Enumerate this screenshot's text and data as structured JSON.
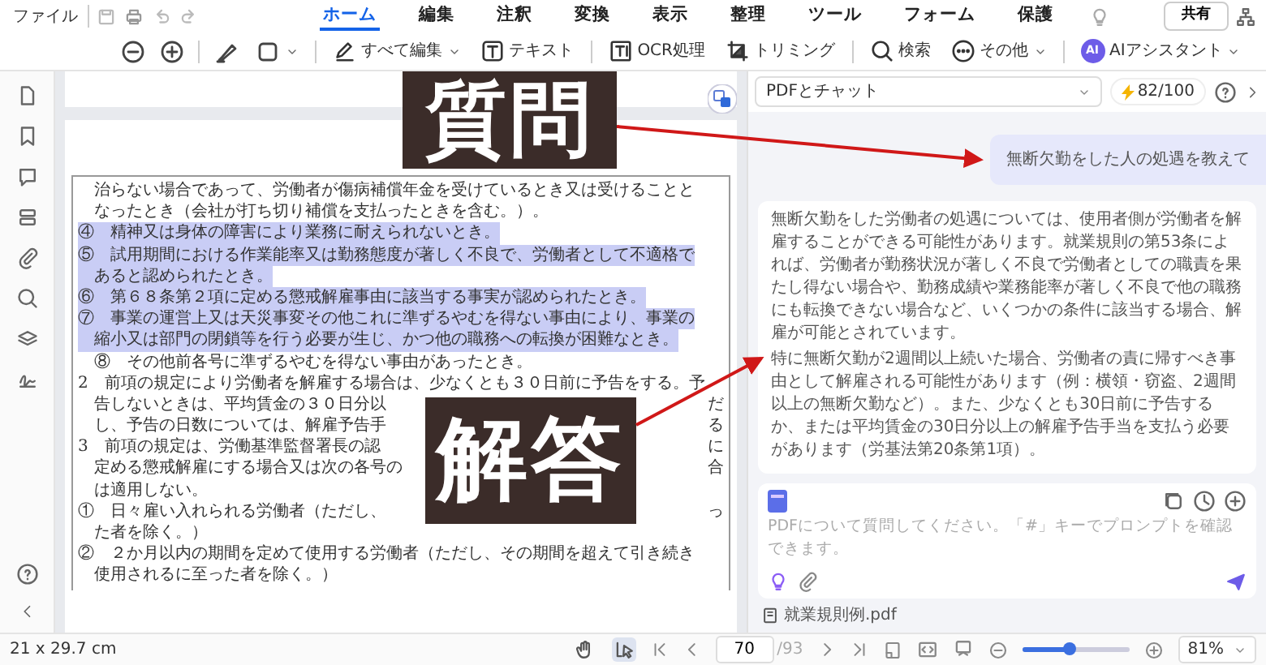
{
  "menu": {
    "file": "ファイル",
    "tabs": [
      {
        "label": "ホーム",
        "selected": true
      },
      {
        "label": "編集",
        "selected": false
      },
      {
        "label": "注釈",
        "selected": false
      },
      {
        "label": "変換",
        "selected": false
      },
      {
        "label": "表示",
        "selected": false
      },
      {
        "label": "整理",
        "selected": false
      },
      {
        "label": "ツール",
        "selected": false
      },
      {
        "label": "フォーム",
        "selected": false
      },
      {
        "label": "保護",
        "selected": false
      }
    ],
    "share": "共有"
  },
  "toolbar": {
    "tools": [
      {
        "label": "すべて編集",
        "dropdown": true
      },
      {
        "label": "テキスト",
        "dropdown": false
      },
      {
        "label": "OCR処理",
        "dropdown": false
      },
      {
        "label": "トリミング",
        "dropdown": false
      },
      {
        "label": "検索",
        "dropdown": false
      },
      {
        "label": "その他",
        "dropdown": true
      },
      {
        "label": "AIアシスタント",
        "dropdown": true
      }
    ],
    "ai_badge": "AI"
  },
  "document": {
    "lines": [
      {
        "text": "治らない場合であって、労働者が傷病補償年金を受けているとき又は受けることと",
        "hanging": true,
        "highlighted": false
      },
      {
        "text": "なったとき（会社が打ち切り補償を支払ったときを含む。）。",
        "hanging": true,
        "highlighted": false
      },
      {
        "text": "④　精神又は身体の障害により業務に耐えられないとき。",
        "hanging": false,
        "highlighted": true
      },
      {
        "text": "⑤　試用期間における作業能率又は勤務態度が著しく不良で、労働者として不適格で",
        "hanging": false,
        "highlighted": true
      },
      {
        "text": "あると認められたとき。",
        "hanging": true,
        "highlighted": true
      },
      {
        "text": "⑥　第６８条第２項に定める懲戒解雇事由に該当する事実が認められたとき。",
        "hanging": false,
        "highlighted": true
      },
      {
        "text": "⑦　事業の運営上又は天災事変その他これに準ずるやむを得ない事由により、事業の",
        "hanging": false,
        "highlighted": true
      },
      {
        "text": "縮小又は部門の閉鎖等を行う必要が生じ、かつ他の職務への転換が困難なとき。",
        "hanging": true,
        "highlighted": true
      },
      {
        "text": "⑧　その他前各号に準ずるやむを得ない事由があったとき。",
        "hanging": true,
        "highlighted": false
      },
      {
        "text": "2　前項の規定により労働者を解雇する場合は、少なくとも３０日前に予告をする。予",
        "hanging": false,
        "highlighted": false
      },
      {
        "text": "告しないときは、平均賃金の３０日分以",
        "right": "だ",
        "hanging": true,
        "highlighted": false
      },
      {
        "text": "し、予告の日数については、解雇予告手",
        "right": "る",
        "hanging": true,
        "highlighted": false
      },
      {
        "text": "3　前項の規定は、労働基準監督署長の認",
        "right": "に",
        "hanging": false,
        "highlighted": false
      },
      {
        "text": "定める懲戒解雇にする場合又は次の各号の",
        "right": "合",
        "hanging": true,
        "highlighted": false
      },
      {
        "text": "は適用しない。",
        "hanging": true,
        "highlighted": false
      },
      {
        "text": "①　日々雇い入れられる労働者（ただし、",
        "right": "っ",
        "hanging": false,
        "highlighted": false
      },
      {
        "text": "た者を除く。）",
        "hanging": true,
        "highlighted": false
      },
      {
        "text": "②　２か月以内の期間を定めて使用する労働者（ただし、その期間を超えて引き続き",
        "hanging": false,
        "highlighted": false
      },
      {
        "text": "使用されるに至った者を除く。）",
        "hanging": true,
        "highlighted": false
      }
    ]
  },
  "chat": {
    "mode": "PDFとチャット",
    "quota": "82/100",
    "question": "無断欠勤をした人の処遇を教えて",
    "answer": [
      "無断欠勤をした労働者の処遇については、使用者側が労働者を解雇することができる可能性があります。就業規則の第53条によれば、労働者が勤務状況が著しく不良で労働者としての職責を果たし得ない場合や、勤務成績や業務能率が著しく不良で他の職務にも転換できない場合など、いくつかの条件に該当する場合、解雇が可能とされています。",
      "特に無断欠勤が2週間以上続いた場合、労働者の責に帰すべき事由として解雇される可能性があります（例：横領・窃盗、2週間以上の無断欠勤など）。また、少なくとも30日前に予告するか、または平均賃金の30日分以上の解雇予告手当を支払う必要があります（労基法第20条第1項）。"
    ],
    "placeholder": "PDFについて質問してください。「#」キーでプロンプトを確認できます。",
    "attachment": "就業規則例.pdf"
  },
  "status_bar": {
    "page_size": "21 x 29.7 cm",
    "tools": [
      {
        "selected": false
      },
      {
        "selected": true
      }
    ],
    "page": "70",
    "page_total": "/93",
    "zoom_slider": {
      "level": 0.45
    },
    "zoom": "81%"
  },
  "annotations": [
    {
      "text": "質問"
    },
    {
      "text": "解答"
    }
  ]
}
